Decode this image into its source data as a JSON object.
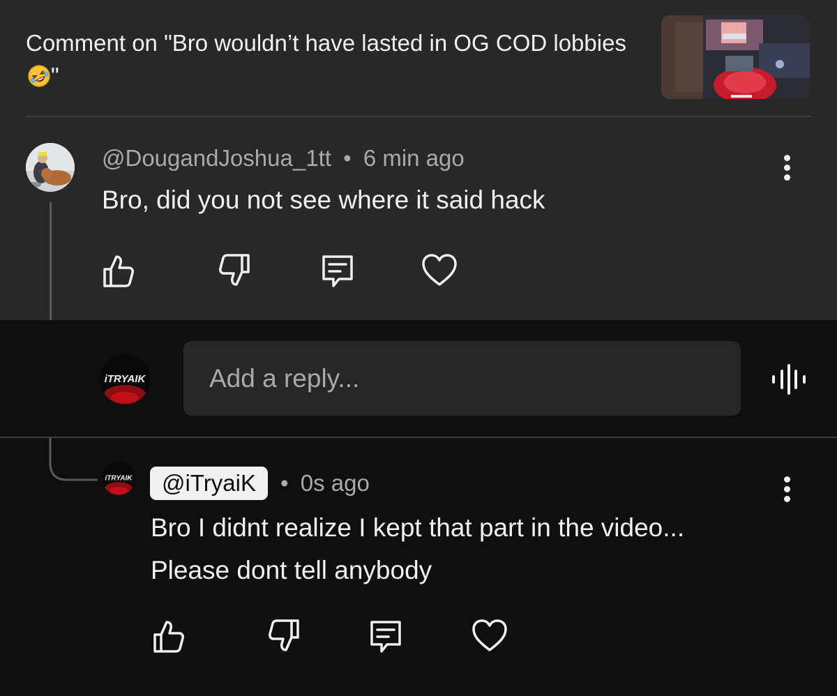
{
  "header": {
    "title_prefix": "Comment on \"Bro wouldn’t have lasted in OG COD lobbies",
    "title_suffix": "\"",
    "emoji": "rolling-on-floor-laughing-emoji",
    "thumbnail_label": "video-thumbnail"
  },
  "comment": {
    "author": "@DougandJoshua_1tt",
    "separator": "•",
    "time": "6 min ago",
    "text": "Bro, did you not see where it said hack",
    "actions": [
      "thumbs-up-icon",
      "thumbs-down-icon",
      "reply-icon",
      "heart-icon"
    ]
  },
  "reply_box": {
    "avatar_text": "iTRYAIK",
    "placeholder": "Add a reply...",
    "voice_icon": "voice-search-icon"
  },
  "reply": {
    "author": "@iTryaiK",
    "separator": "•",
    "time": "0s ago",
    "line1": "Bro I didnt realize I kept that part in the video...",
    "line2": "Please dont tell anybody",
    "actions": [
      "thumbs-up-icon",
      "thumbs-down-icon",
      "reply-icon",
      "heart-icon"
    ]
  },
  "colors": {
    "top_background": "#282828",
    "page_background": "#0f0f0f",
    "input_background": "#272727",
    "primary_text": "#f1f1f1",
    "secondary_text": "#aaaaaa",
    "accent_red": "#c0101a"
  }
}
